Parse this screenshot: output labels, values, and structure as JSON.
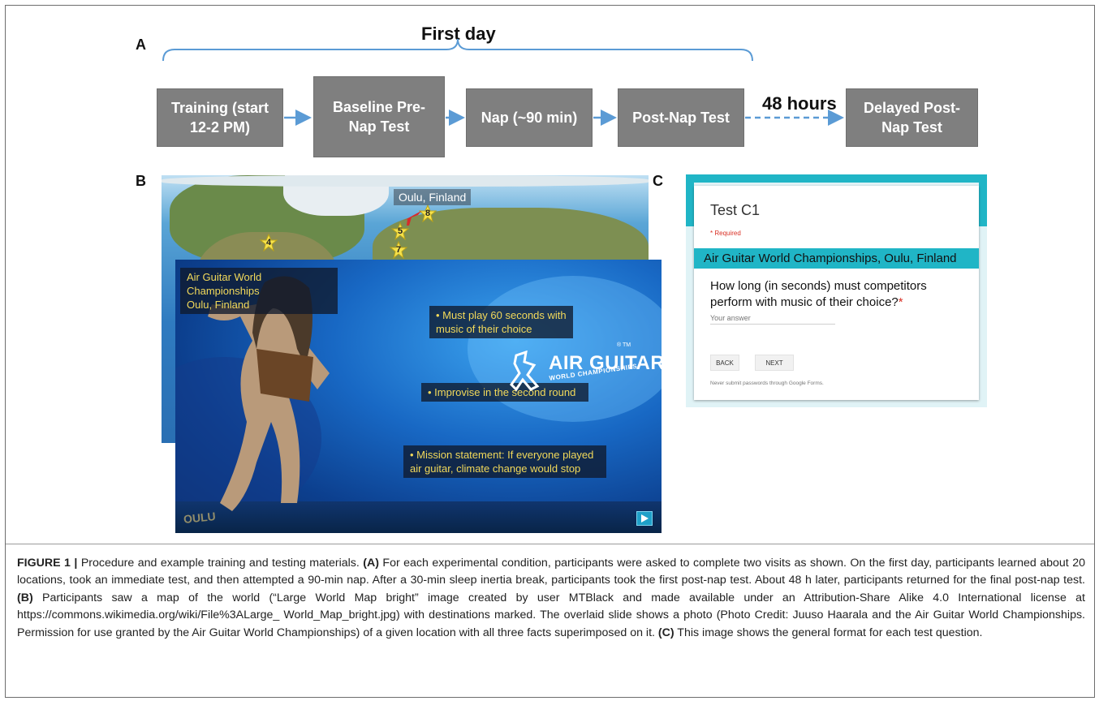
{
  "panels": {
    "a": "A",
    "b": "B",
    "c": "C"
  },
  "timeline": {
    "group_label": "First day",
    "steps": [
      {
        "label": "Training (start 12-2 PM)"
      },
      {
        "label": "Baseline Pre-Nap Test"
      },
      {
        "label": "Nap (~90 min)"
      },
      {
        "label": "Post-Nap Test"
      }
    ],
    "gap_label": "48 hours",
    "final_step": {
      "label": "Delayed Post-Nap Test"
    },
    "colors": {
      "box": "#7f7f7f",
      "arrow": "#5b9bd5",
      "brace": "#5b9bd5"
    }
  },
  "map": {
    "location_label": "Oulu, Finland",
    "pins": [
      "4",
      "5",
      "7",
      "8"
    ]
  },
  "slide": {
    "title": "Air Guitar World Championships\nOulu, Finland",
    "facts": [
      "•  Must play 60 seconds with music of their choice",
      "•  Improvise in the second round",
      "•  Mission statement: If everyone played air guitar, climate change would stop"
    ],
    "logo_text": "AIR GUITAR",
    "logo_subtext": "WORLD CHAMPIONSHIPS",
    "logo_tm": "® TM",
    "banner_text": "OULU"
  },
  "form": {
    "title": "Test C1",
    "required_note": "* Required",
    "section_title": "Air Guitar World Championships, Oulu, Finland",
    "question": "How long (in seconds) must competitors perform with music of their choice?",
    "asterisk": "*",
    "answer_placeholder": "Your answer",
    "back_label": "BACK",
    "next_label": "NEXT",
    "footer_note": "Never submit passwords through Google Forms.",
    "accent_color": "#20b5c6"
  },
  "caption": {
    "label": "FIGURE 1",
    "separator": " | ",
    "intro": "Procedure and example training and testing materials. ",
    "a_marker": "(A)",
    "a_text": " For each experimental condition, participants were asked to complete two visits as shown. On the first day, participants learned about 20 locations, took an immediate test, and then attempted a 90-min nap. After a 30-min sleep inertia break, participants took the first post-nap test. About 48 h later, participants returned for the final post-nap test. ",
    "b_marker": "(B)",
    "b_text": " Participants saw a map of the world (“Large World Map bright” image created by user MTBlack and made available under an Attribution-Share Alike 4.0 International license at https://commons.wikimedia.org/wiki/File%3ALarge_ World_Map_bright.jpg) with destinations marked. The overlaid slide shows a photo (Photo Credit: Juuso Haarala and the Air Guitar World Championships. Permission for use granted by the Air Guitar World Championships) of a given location with all three facts superimposed on it. ",
    "c_marker": "(C)",
    "c_text": " This image shows the general format for each test question."
  }
}
